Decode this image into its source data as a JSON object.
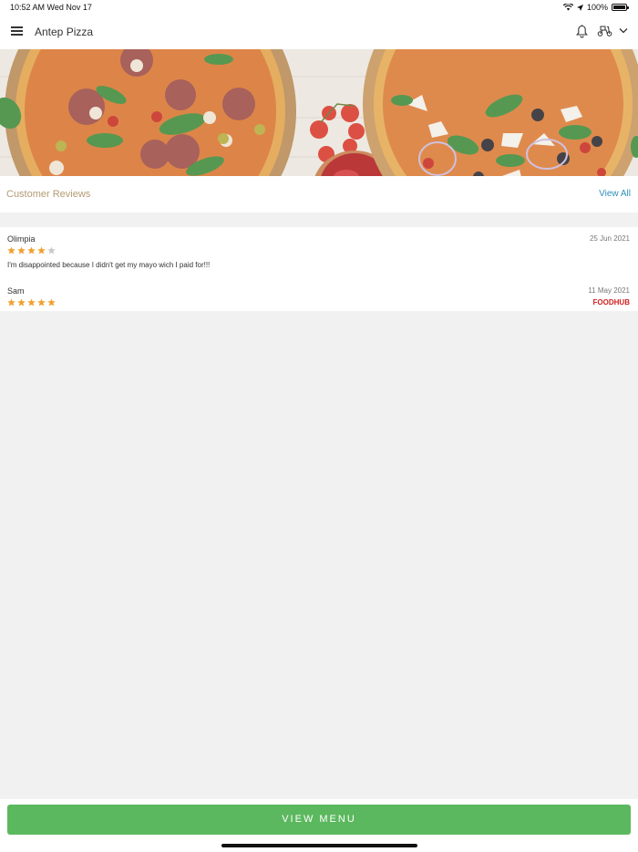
{
  "status_bar": {
    "time": "10:52 AM",
    "date": "Wed Nov 17",
    "battery": "100%"
  },
  "nav": {
    "title": "Antep Pizza",
    "icons": [
      "menu-icon",
      "bell-icon",
      "scooter-icon",
      "chevron-down-icon"
    ]
  },
  "reviews": {
    "title": "Customer Reviews",
    "view_all": "View All",
    "items": [
      {
        "name": "Olimpia",
        "date": "25 Jun 2021",
        "rating": 4,
        "comment": "I'm disappointed because I didn't get my mayo wich I paid for!!!"
      },
      {
        "name": "Sam",
        "date": "11 May 2021",
        "rating": 5,
        "source": "FOODHUB"
      }
    ]
  },
  "cta": {
    "label": "VIEW MENU"
  },
  "colors": {
    "accent_green": "#5cb85f",
    "link_blue": "#2f8fba",
    "reviews_title": "#b49a74",
    "star": "#f0a030",
    "star_empty": "#c8c8c8",
    "foodhub_red": "#d32020"
  }
}
